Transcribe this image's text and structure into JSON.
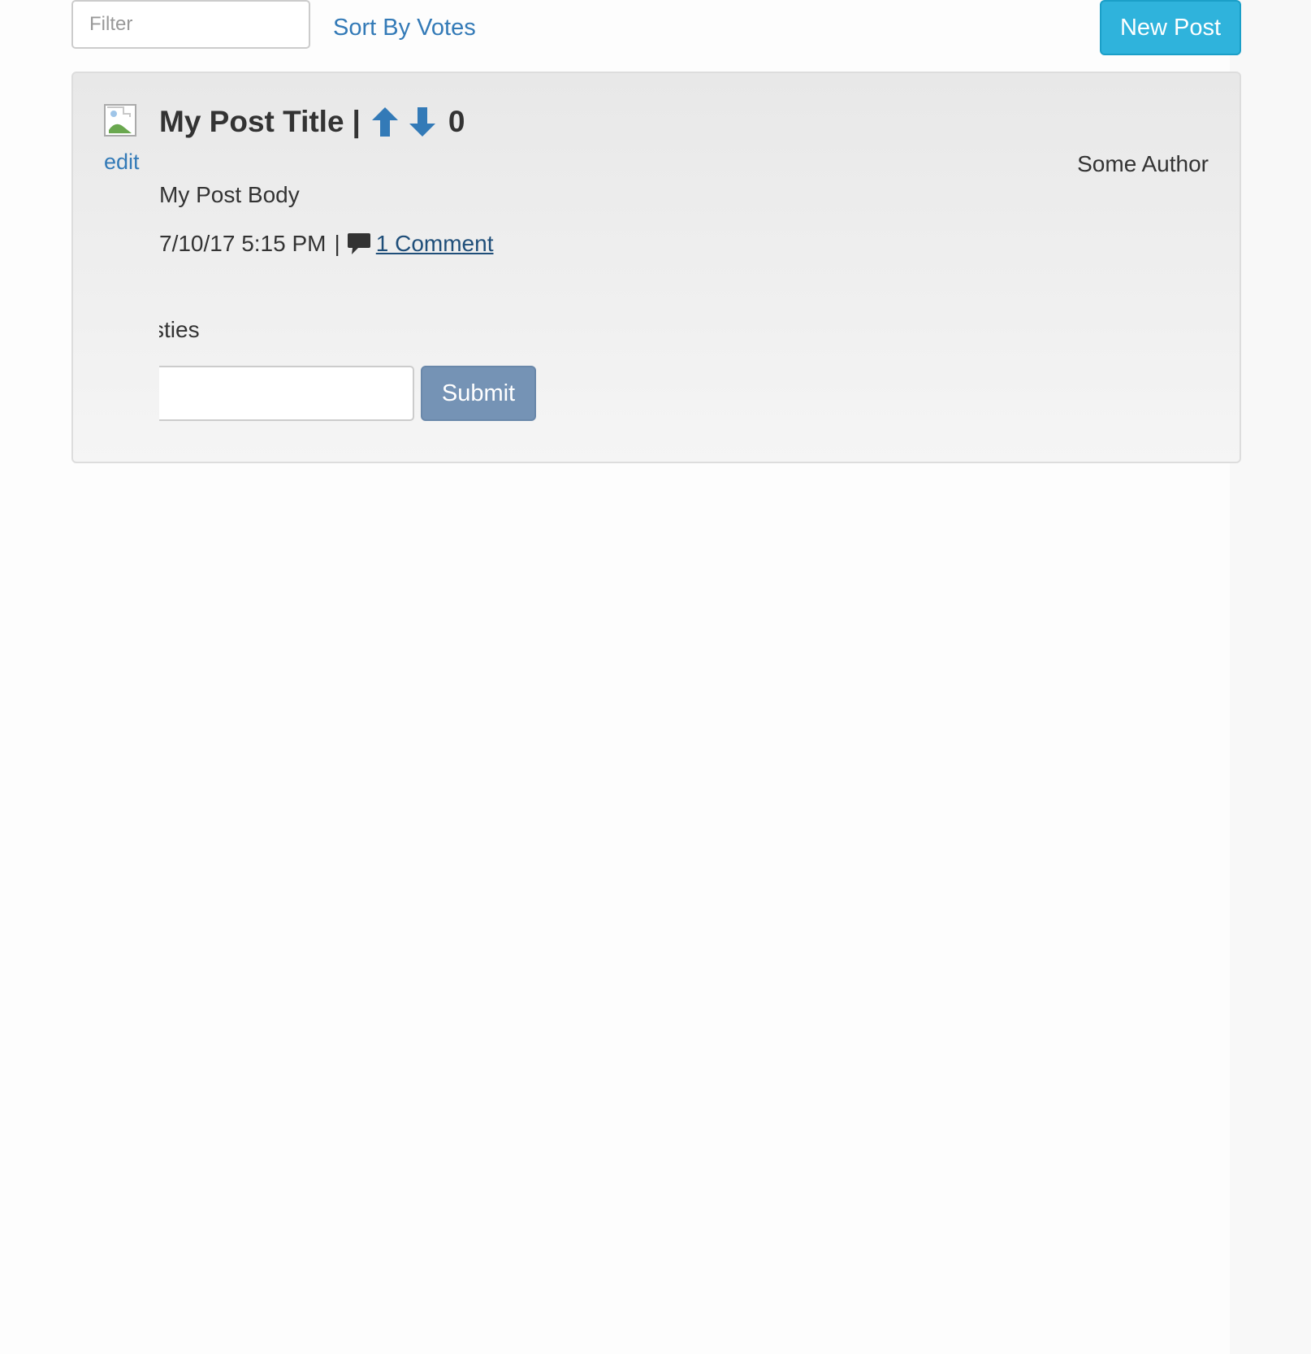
{
  "toolbar": {
    "filter_placeholder": "Filter",
    "filter_value": "",
    "sort_label": "Sort By Votes",
    "new_post_label": "New Post"
  },
  "post": {
    "image_icon": "broken-image-icon",
    "edit_label": "edit",
    "title": "My Post Title",
    "title_separator": "|",
    "upvote_icon": "arrow-up-icon",
    "downvote_icon": "arrow-down-icon",
    "votes": "0",
    "author": "Some Author",
    "body": "My Post Body",
    "timestamp": "7/10/17 5:15 PM",
    "meta_separator": "|",
    "comment_icon": "speech-bubble-icon",
    "comments_label": "1 Comment"
  },
  "comment_form": {
    "label_partial": "sties",
    "input_value": "",
    "submit_label": "Submit"
  },
  "colors": {
    "link": "#337ab7",
    "new_post_button": "#2fb3dc",
    "submit_button": "#7593b5",
    "panel_background": "#ececec",
    "text": "#333333"
  }
}
